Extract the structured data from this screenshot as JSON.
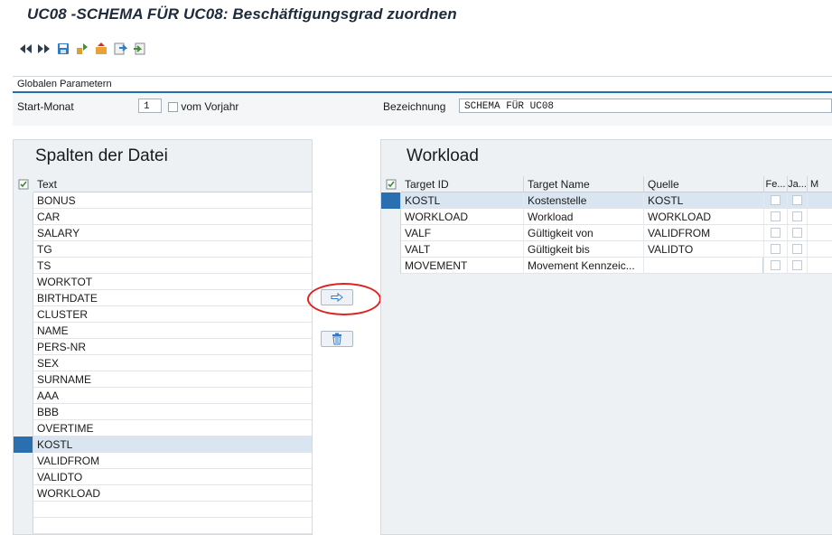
{
  "window": {
    "title": "UC08 -SCHEMA FÜR UC08: Beschäftigungsgrad zuordnen"
  },
  "toolbar": {
    "icons": [
      "first-page-icon",
      "last-page-icon",
      "save-icon",
      "transport-icon",
      "import-icon",
      "export-icon",
      "copy-icon"
    ]
  },
  "params": {
    "header": "Globalen Parametern",
    "start_month_label": "Start-Monat",
    "start_month_value": "1",
    "prev_year_label": "vom Vorjahr",
    "description_label": "Bezeichnung",
    "description_value": "SCHEMA FÜR UC08"
  },
  "left_panel": {
    "title": "Spalten der Datei",
    "column_header": "Text",
    "rows": [
      "BONUS",
      "CAR",
      "SALARY",
      "TG",
      "TS",
      "WORKTOT",
      "BIRTHDATE",
      "CLUSTER",
      "NAME",
      "PERS-NR",
      "SEX",
      "SURNAME",
      "AAA",
      "BBB",
      "OVERTIME",
      "KOSTL",
      "VALIDFROM",
      "VALIDTO",
      "WORKLOAD"
    ],
    "selected_index": 15
  },
  "right_panel": {
    "title": "Workload",
    "headers": [
      "Target ID",
      "Target Name",
      "Quelle",
      "Fe...",
      "Ja...",
      "M"
    ],
    "rows": [
      {
        "target_id": "KOSTL",
        "target_name": "Kostenstelle",
        "quelle": "KOSTL"
      },
      {
        "target_id": "WORKLOAD",
        "target_name": "Workload",
        "quelle": "WORKLOAD"
      },
      {
        "target_id": "VALF",
        "target_name": "Gültigkeit von",
        "quelle": "VALIDFROM"
      },
      {
        "target_id": "VALT",
        "target_name": "Gültigkeit bis",
        "quelle": "VALIDTO"
      },
      {
        "target_id": "MOVEMENT",
        "target_name": "Movement Kennzeic...",
        "quelle": ""
      }
    ],
    "selected_index": 0
  },
  "buttons": {
    "assign_icon": "arrow-right-icon",
    "delete_icon": "trash-icon"
  },
  "colors": {
    "accent": "#1e6fb4",
    "selection": "#2a6fb0",
    "highlight_circle": "#e02020"
  }
}
